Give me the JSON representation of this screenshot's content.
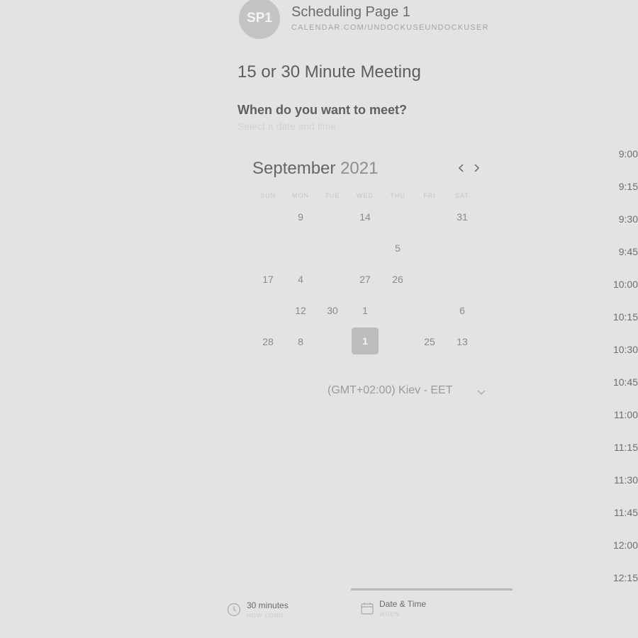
{
  "profile": {
    "initials": "SP1",
    "page_name": "Scheduling Page 1",
    "url": "CALENDAR.COM/UNDOCKUSEUNDOCKUSER"
  },
  "meeting": {
    "title": "15 or 30 Minute Meeting",
    "question": "When do you want to meet?",
    "hint": "Select a date and time"
  },
  "calendar": {
    "month": "September",
    "year": "2021",
    "weekdays": [
      "SUN",
      "MON",
      "TUE",
      "WED",
      "THU",
      "FRI",
      "SAT"
    ],
    "rows": [
      [
        "",
        "9",
        "",
        "14",
        "",
        "",
        "31"
      ],
      [
        "",
        "",
        "",
        "",
        "5",
        "",
        ""
      ],
      [
        "17",
        "4",
        "",
        "27",
        "26",
        "",
        ""
      ],
      [
        "",
        "12",
        "30",
        "1",
        "",
        "",
        "6"
      ],
      [
        "28",
        "8",
        "",
        "1",
        "",
        "25",
        "13"
      ]
    ],
    "selected_day": "1"
  },
  "timezone": {
    "label": "(GMT+02:00) Kiev - EET"
  },
  "time_slots": [
    "9:00",
    "9:15",
    "9:30",
    "9:45",
    "10:00",
    "10:15",
    "10:30",
    "10:45",
    "11:00",
    "11:15",
    "11:30",
    "11:45",
    "12:00",
    "12:15"
  ],
  "footer": {
    "duration": {
      "value": "30 minutes",
      "label": "HOW LONG",
      "icon": "clock-icon"
    },
    "datetime": {
      "value": "Date & Time",
      "label": "WHEN",
      "icon": "calendar-icon"
    }
  },
  "colors": {
    "background": "#e3e3e3",
    "selected_day": "#bcbcbc",
    "avatar": "#c4c4c4"
  }
}
